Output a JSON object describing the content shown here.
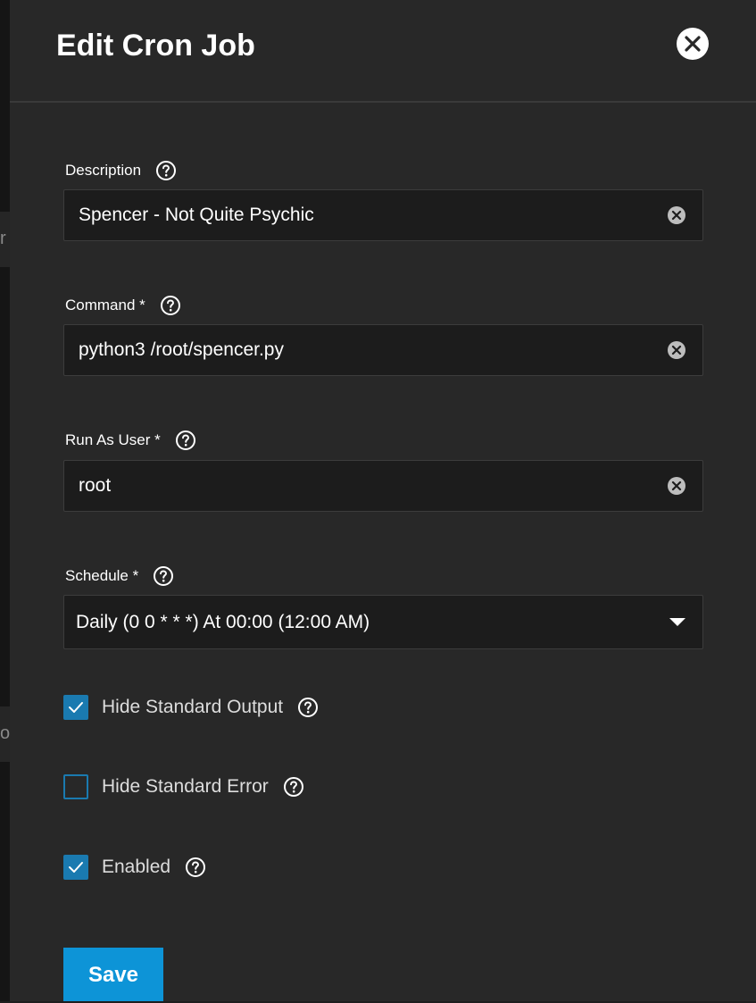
{
  "dialog": {
    "title": "Edit Cron Job"
  },
  "fields": {
    "description": {
      "label": "Description",
      "value": "Spencer - Not Quite Psychic"
    },
    "command": {
      "label": "Command *",
      "value": "python3 /root/spencer.py"
    },
    "run_as_user": {
      "label": "Run As User *",
      "value": "root"
    },
    "schedule": {
      "label": "Schedule *",
      "value": "Daily (0 0 * * *)  At 00:00 (12:00 AM)"
    }
  },
  "checkboxes": {
    "hide_stdout": {
      "label": "Hide Standard Output",
      "checked": true
    },
    "hide_stderr": {
      "label": "Hide Standard Error",
      "checked": false
    },
    "enabled": {
      "label": "Enabled",
      "checked": true
    }
  },
  "actions": {
    "save_label": "Save"
  },
  "colors": {
    "accent": "#0d94d7",
    "checkbox": "#1a7ab0",
    "panel_bg": "#282828",
    "field_bg": "#1c1c1c"
  },
  "icons": {
    "close": "close-icon",
    "help": "help-circle-icon",
    "clear": "clear-input-icon",
    "dropdown": "caret-down-icon",
    "check": "check-icon"
  }
}
